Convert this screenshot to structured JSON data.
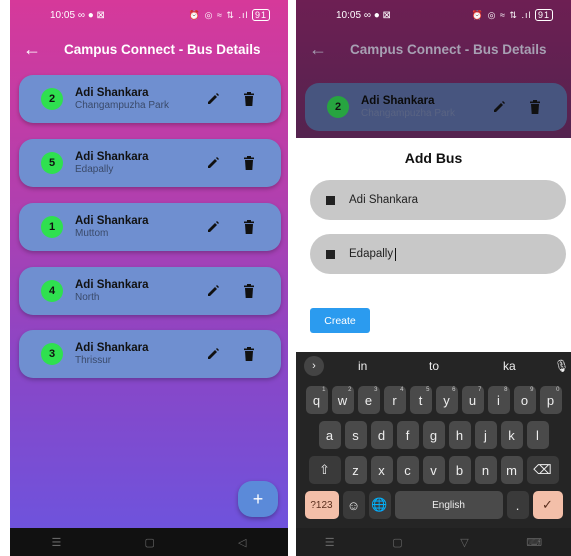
{
  "status": {
    "time": "10:05",
    "left_icons": "∞ ● ⊠",
    "right_icons": "⏰ ◎ ≈ ⇅ .ıl",
    "battery": "91"
  },
  "left_screen": {
    "appbar": {
      "back_icon": "arrow-left-icon",
      "title": "Campus Connect - Bus Details"
    },
    "buses": [
      {
        "number": "2",
        "name": "Adi Shankara",
        "stop": "Changampuzha Park"
      },
      {
        "number": "5",
        "name": "Adi Shankara",
        "stop": "Edapally"
      },
      {
        "number": "1",
        "name": "Adi Shankara",
        "stop": "Muttom"
      },
      {
        "number": "4",
        "name": "Adi Shankara",
        "stop": "North"
      },
      {
        "number": "3",
        "name": "Adi Shankara",
        "stop": "Thrissur"
      }
    ],
    "fab_label": "+"
  },
  "right_screen": {
    "appbar": {
      "title": "Campus Connect - Bus Details"
    },
    "bus": {
      "number": "2",
      "name": "Adi Shankara",
      "stop": "Changampuzha Park"
    },
    "sheet": {
      "title": "Add Bus",
      "field1_value": "Adi Shankara",
      "field2_value": "Edapally",
      "create_label": "Create"
    },
    "keyboard": {
      "suggestions": [
        "in",
        "to",
        "ka"
      ],
      "row1": [
        {
          "k": "q",
          "n": "1"
        },
        {
          "k": "w",
          "n": "2"
        },
        {
          "k": "e",
          "n": "3"
        },
        {
          "k": "r",
          "n": "4"
        },
        {
          "k": "t",
          "n": "5"
        },
        {
          "k": "y",
          "n": "6"
        },
        {
          "k": "u",
          "n": "7"
        },
        {
          "k": "i",
          "n": "8"
        },
        {
          "k": "o",
          "n": "9"
        },
        {
          "k": "p",
          "n": "0"
        }
      ],
      "row2": [
        "a",
        "s",
        "d",
        "f",
        "g",
        "h",
        "j",
        "k",
        "l"
      ],
      "row3": [
        "z",
        "x",
        "c",
        "v",
        "b",
        "n",
        "m"
      ],
      "mode_label": "?123",
      "space_label": "English",
      "period_label": "."
    }
  },
  "colors": {
    "accent_blue": "#2b9bef",
    "badge_green": "#2fe04f",
    "card_blue": "#6f8fd0",
    "gradient_top": "#d6399a",
    "gradient_bottom": "#6a55e0"
  }
}
